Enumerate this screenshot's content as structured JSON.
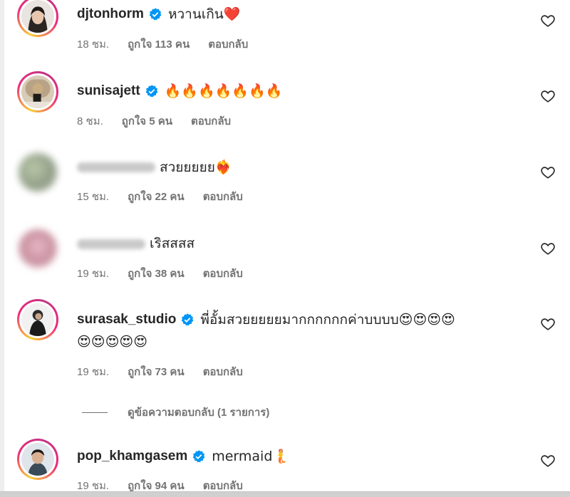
{
  "comments": [
    {
      "username": "djtonhorm",
      "verified": true,
      "text": "หวานเกิน❤️",
      "time": "18 ชม.",
      "likes": "ถูกใจ 113 คน",
      "reply": "ตอบกลับ"
    },
    {
      "username": "sunisajett",
      "verified": true,
      "text": "🔥🔥🔥🔥🔥🔥🔥",
      "time": "8 ชม.",
      "likes": "ถูกใจ 5 คน",
      "reply": "ตอบกลับ"
    },
    {
      "username": "",
      "verified": false,
      "text": "สวยยยยย❤️‍🔥",
      "time": "15 ชม.",
      "likes": "ถูกใจ 22 คน",
      "reply": "ตอบกลับ"
    },
    {
      "username": "",
      "verified": false,
      "text": "เริสสสส",
      "time": "19 ชม.",
      "likes": "ถูกใจ 38 คน",
      "reply": "ตอบกลับ"
    },
    {
      "username": "surasak_studio",
      "verified": true,
      "text": "พี่อั้มสวยยยยยมากกกกกกค่าบบบบ😍😍😍😍",
      "text2": "😍😍😍😍😍",
      "time": "19 ชม.",
      "likes": "ถูกใจ 73 คน",
      "reply": "ตอบกลับ"
    },
    {
      "username": "pop_khamgasem",
      "verified": true,
      "text": "mermaid🧜",
      "time": "19 ชม.",
      "likes": "ถูกใจ 94 คน",
      "reply": "ตอบกลับ"
    }
  ],
  "view_replies": "ดูข้อความตอบกลับ (1 รายการ)",
  "icons": {
    "verified": "verified-badge-icon",
    "like": "heart-outline-icon"
  },
  "colors": {
    "verified": "#0095f6",
    "meta": "#737373",
    "text": "#262626"
  }
}
